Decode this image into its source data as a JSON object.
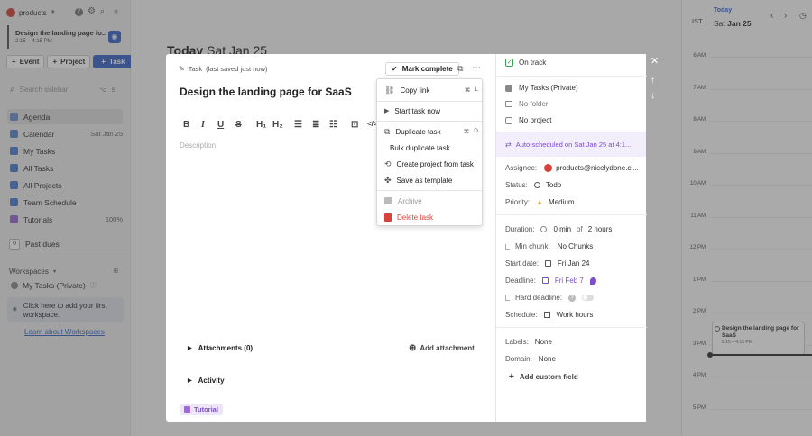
{
  "sidebar": {
    "workspace_name": "products",
    "current_task": {
      "title": "Design the landing page fo...",
      "time": "2:15 – 4:15 PM"
    },
    "buttons": {
      "event": "Event",
      "project": "Project",
      "task": "Task"
    },
    "search_placeholder": "Search sidebar",
    "search_shortcut": "⌥ S",
    "nav": [
      {
        "label": "Agenda"
      },
      {
        "label": "Calendar",
        "meta": "Sat Jan 25"
      },
      {
        "label": "My Tasks"
      },
      {
        "label": "All Tasks"
      },
      {
        "label": "All Projects"
      },
      {
        "label": "Team Schedule"
      },
      {
        "label": "Tutorials",
        "meta": "100%"
      }
    ],
    "past_dues_count": "0",
    "past_dues_label": "Past dues",
    "workspaces_label": "Workspaces",
    "my_tasks_private": "My Tasks (Private)",
    "add_workspace_hint": "Click here to add your first workspace.",
    "learn_link": "Learn about Workspaces"
  },
  "main": {
    "heading_bold": "Today",
    "heading_date": "Sat Jan 25"
  },
  "calendar": {
    "today_link": "Today",
    "timezone": "IST",
    "date_prefix": "Sat",
    "date_main": "Jan 25",
    "times": [
      "6 AM",
      "7 AM",
      "8 AM",
      "9 AM",
      "10 AM",
      "11 AM",
      "12 PM",
      "1 PM",
      "2 PM",
      "3 PM",
      "4 PM",
      "5 PM"
    ],
    "event_title": "Design the landing page for SaaS",
    "event_time": "2:15 – 4:15 PM"
  },
  "modal": {
    "breadcrumb_type": "Task",
    "breadcrumb_status": "(last saved just now)",
    "mark_complete": "Mark complete",
    "title": "Design the landing page for SaaS",
    "description_placeholder": "Description",
    "attachments_label": "Attachments (0)",
    "add_attachment": "Add attachment",
    "activity_label": "Activity",
    "tutorial_badge": "Tutorial",
    "props": {
      "on_track": "On track",
      "project_space": "My Tasks (Private)",
      "folder": "No folder",
      "project": "No project",
      "auto_scheduled": "Auto-scheduled on Sat Jan 25 at 4:1...",
      "assignee_label": "Assignee:",
      "assignee_value": "products@nicelydone.cl...",
      "status_label": "Status:",
      "status_value": "Todo",
      "priority_label": "Priority:",
      "priority_value": "Medium",
      "duration_label": "Duration:",
      "duration_min": "0 min",
      "duration_of": "of",
      "duration_value": "2 hours",
      "min_chunk_label": "Min chunk:",
      "min_chunk_value": "No Chunks",
      "start_date_label": "Start date:",
      "start_date_value": "Fri Jan 24",
      "deadline_label": "Deadline:",
      "deadline_value": "Fri Feb 7",
      "hard_deadline_label": "Hard deadline:",
      "schedule_label": "Schedule:",
      "schedule_value": "Work hours",
      "labels_label": "Labels:",
      "labels_value": "None",
      "domain_label": "Domain:",
      "domain_value": "None",
      "add_custom_field": "Add custom field"
    }
  },
  "context_menu": {
    "copy_link": "Copy link",
    "copy_link_kbd": [
      "⌘",
      "L"
    ],
    "start_task": "Start task now",
    "duplicate": "Duplicate task",
    "duplicate_kbd": [
      "⌘",
      "D"
    ],
    "bulk_duplicate": "Bulk duplicate task",
    "create_project": "Create project from task",
    "save_template": "Save as template",
    "archive": "Archive",
    "delete": "Delete task"
  },
  "colors": {
    "accent": "#3b67c9",
    "green": "#3aa35a",
    "purple": "#7a4fc9",
    "red": "#d9413b",
    "orange": "#f0a030"
  }
}
